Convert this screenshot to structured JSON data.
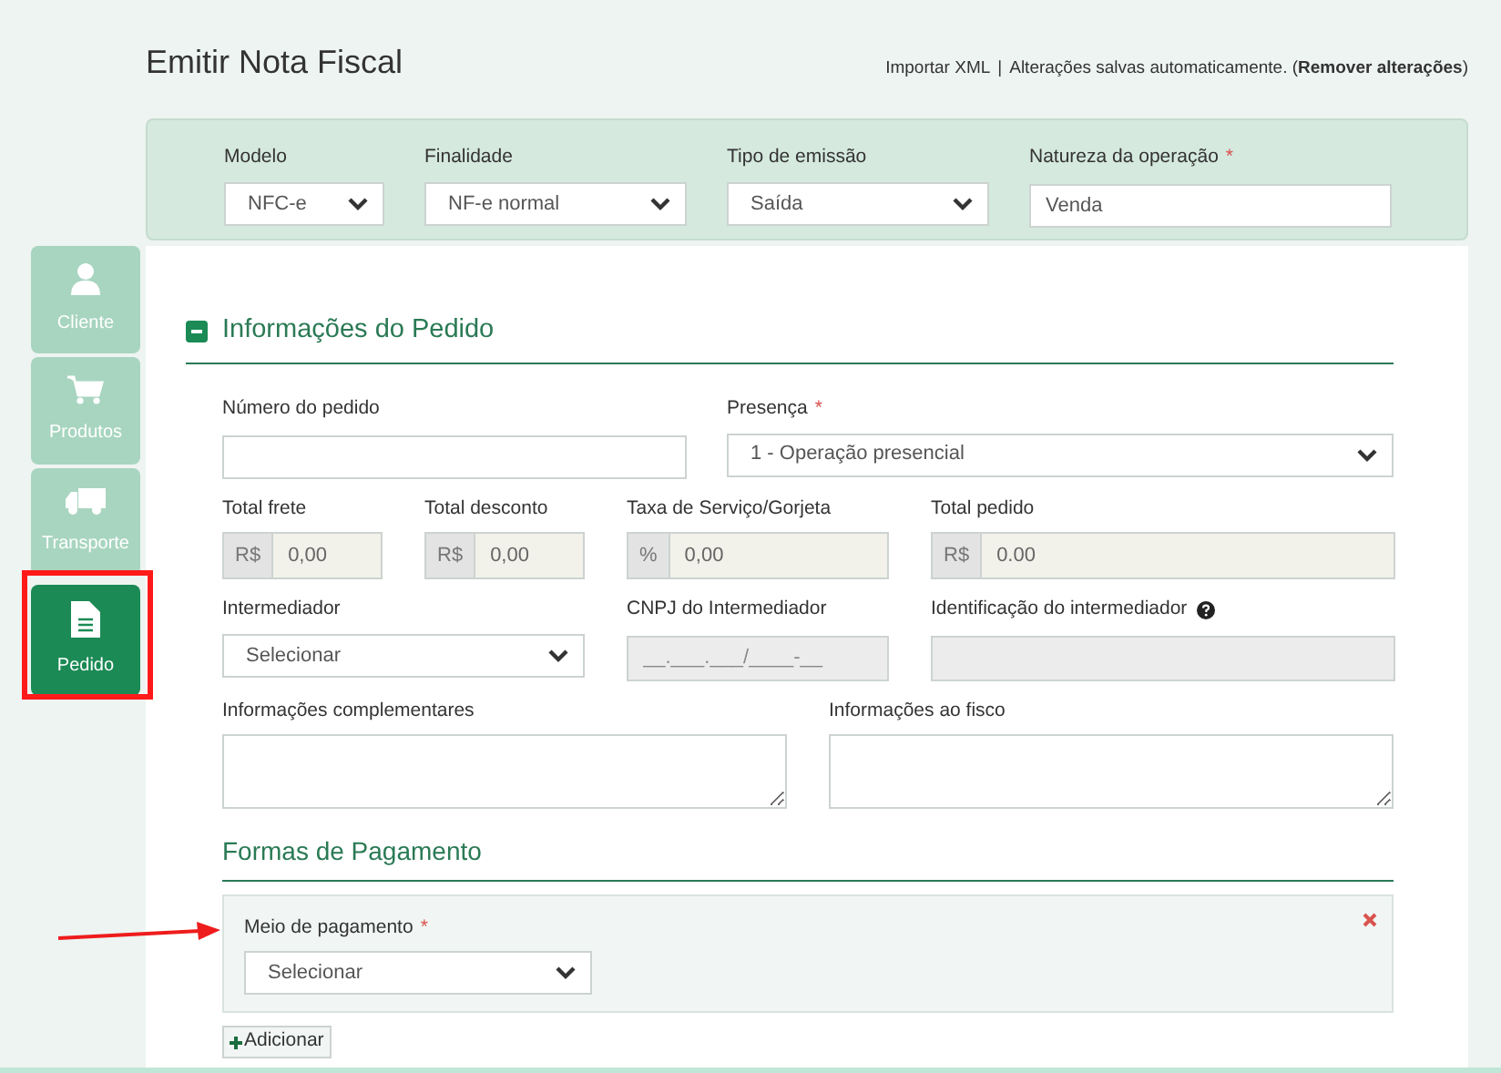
{
  "header": {
    "title": "Emitir Nota Fiscal",
    "import_link": "Importar XML",
    "separator": "|",
    "status": "Alterações salvas automaticamente. (**Remover alterações**)"
  },
  "top_fields": [
    {
      "label": "Modelo",
      "kind": "select",
      "value": "NFC-e"
    },
    {
      "label": "Finalidade",
      "kind": "select",
      "value": "NF-e normal"
    },
    {
      "label": "Tipo de emissão",
      "kind": "select",
      "value": "Saída"
    },
    {
      "label": "Natureza da operação",
      "required_mark": "*",
      "kind": "text",
      "value": "Venda"
    }
  ],
  "sidebar": {
    "items": [
      {
        "label": "Cliente",
        "kind": "person",
        "selected": false
      },
      {
        "label": "Produtos",
        "kind": "cart",
        "selected": false
      },
      {
        "label": "Transporte",
        "kind": "truck",
        "selected": false
      },
      {
        "label": "Pedido",
        "kind": "document",
        "selected": true
      }
    ]
  },
  "order_section": {
    "title": "Informações do Pedido",
    "rows": [
      {
        "fields": [
          {
            "label": "Número do pedido",
            "kind": "text"
          },
          {
            "label": "Presença",
            "required_mark": "*",
            "kind": "select",
            "value": "1 - Operação presencial"
          }
        ]
      },
      {
        "fields": [
          {
            "label": "Total frete",
            "kind": "addon",
            "prefix": "R$",
            "value": "0,00"
          },
          {
            "label": "Total desconto",
            "kind": "addon",
            "prefix": "R$",
            "value": "0,00"
          },
          {
            "label": "Taxa de Serviço/Gorjeta",
            "kind": "addon",
            "prefix": "%",
            "value": "0,00"
          },
          {
            "label": "Total pedido",
            "kind": "addon",
            "prefix": "R$",
            "value": "0.00"
          }
        ]
      },
      {
        "fields": [
          {
            "label": "Intermediador",
            "kind": "select",
            "value": "Selecionar"
          },
          {
            "label": "CNPJ do Intermediador",
            "kind": "disabled",
            "placeholder": "__.___.___/____-__"
          },
          {
            "label": "Identificação do intermediador",
            "kind": "disabled",
            "help": true
          }
        ]
      },
      {
        "fields": [
          {
            "label": "Informações complementares",
            "kind": "textarea"
          },
          {
            "label": "Informações ao fisco",
            "kind": "textarea"
          }
        ]
      }
    ]
  },
  "payment_section": {
    "title": "Formas de Pagamento",
    "entries": [
      {
        "label": "Meio de pagamento",
        "required_mark": "*",
        "value": "Selecionar"
      }
    ],
    "add_button": "Adicionar"
  }
}
